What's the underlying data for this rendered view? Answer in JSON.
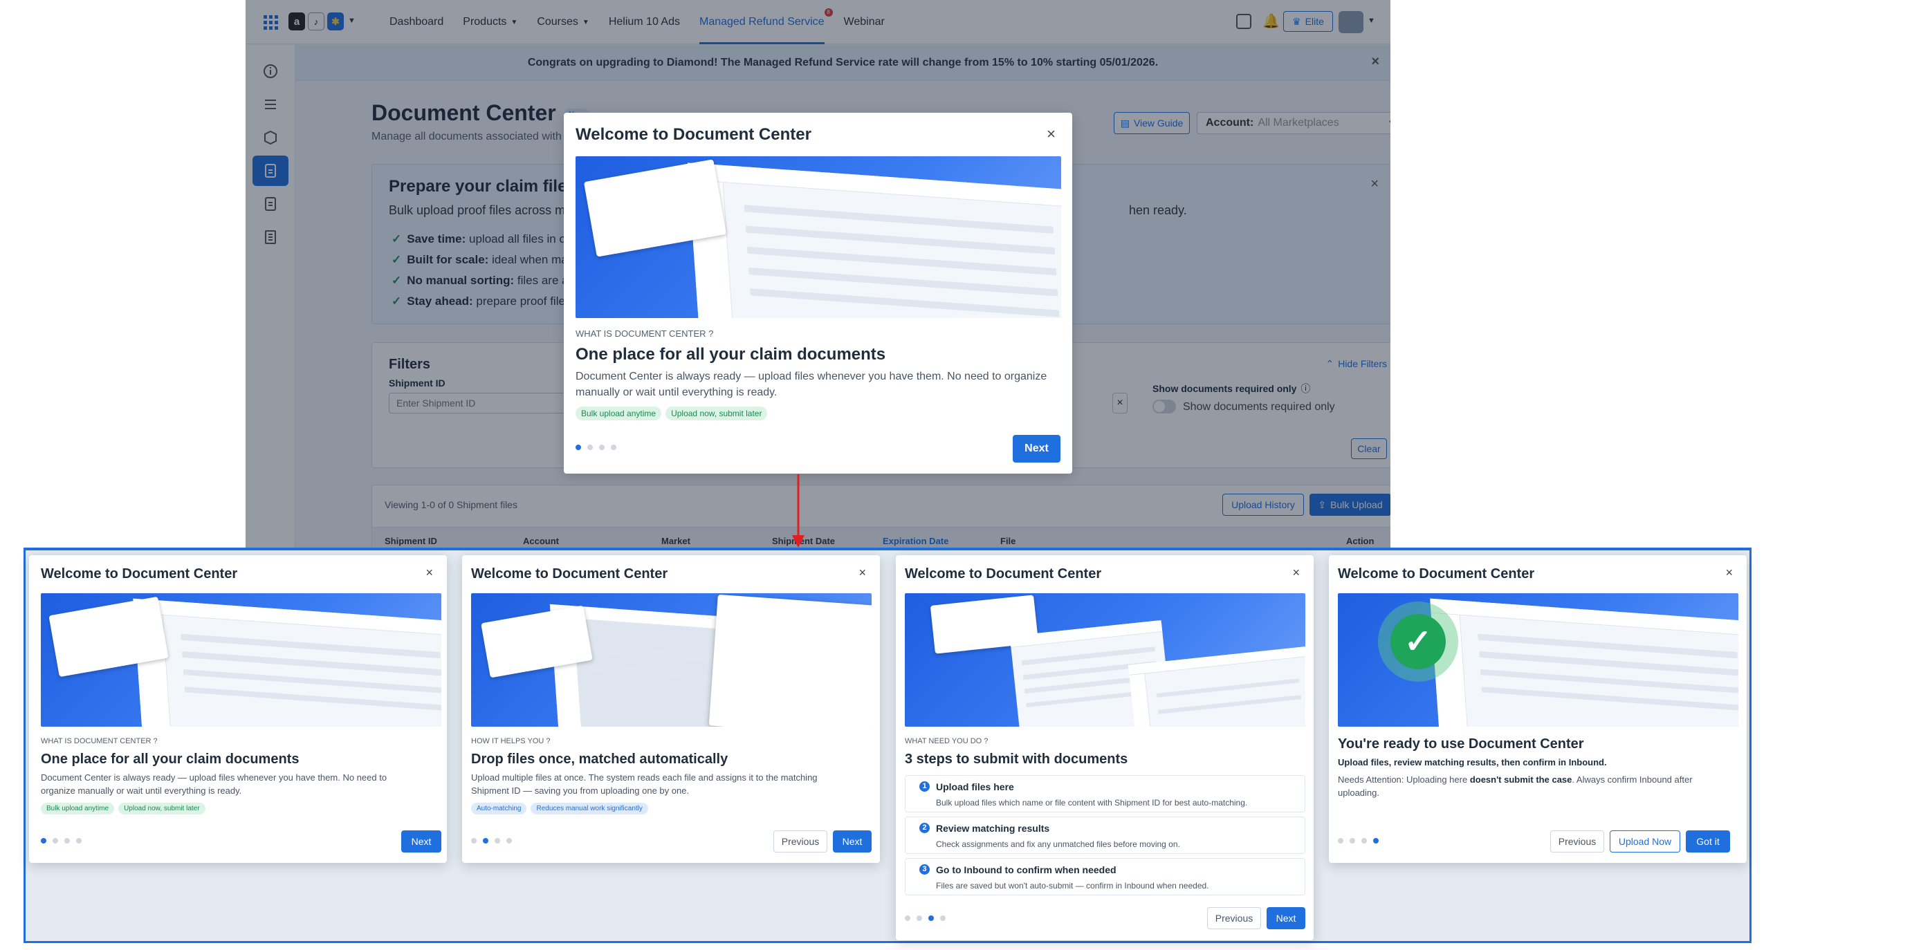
{
  "nav": {
    "items": [
      {
        "label": "Dashboard"
      },
      {
        "label": "Products"
      },
      {
        "label": "Courses"
      },
      {
        "label": "Helium 10 Ads"
      },
      {
        "label": "Managed Refund Service"
      },
      {
        "label": "Webinar"
      }
    ],
    "mrs_badge": "8",
    "plan_label": "Elite"
  },
  "banner": {
    "text": "Congrats on upgrading to Diamond! The Managed Refund Service rate will change from 15% to 10% starting 05/01/2026."
  },
  "page": {
    "title": "Document Center",
    "new_badge": "New",
    "subtitle": "Manage all documents associated with your Shipments",
    "view_guide": "View Guide",
    "account_label": "Account:",
    "account_value": "All Marketplaces"
  },
  "prepare": {
    "title": "Prepare your claim files ahead",
    "intro": "Bulk upload proof files across multiple Shipments",
    "intro_tail": "hen ready.",
    "bullets": [
      {
        "bold": "Save time:",
        "text": " upload all files in one go, n"
      },
      {
        "bold": "Built for scale:",
        "text": " ideal when managing"
      },
      {
        "bold": "No manual sorting:",
        "text": " files are auto-ma"
      },
      {
        "bold": "Stay ahead:",
        "text": " prepare proof files before"
      }
    ]
  },
  "filters": {
    "title": "Filters",
    "hide_label": "Hide Filters",
    "shipment_label": "Shipment ID",
    "shipment_placeholder": "Enter Shipment ID",
    "required_label": "Show documents required only",
    "required_toggle_label": "Show documents required only",
    "clear": "Clear"
  },
  "table": {
    "viewing": "Viewing 1-0 of 0 Shipment files",
    "upload_history": "Upload History",
    "bulk_upload": "Bulk Upload",
    "columns": [
      "Shipment ID",
      "Account",
      "Market",
      "Shipment Date",
      "Expiration Date",
      "File",
      "Action"
    ]
  },
  "modal_main": {
    "title": "Welcome to Document Center",
    "eyebrow": "WHAT IS DOCUMENT CENTER ?",
    "heading": "One place for all your claim documents",
    "body": "Document Center is always ready — upload files whenever you have them. No need to organize manually or wait until everything is ready.",
    "chips": [
      "Bulk upload anytime",
      "Upload now, submit later"
    ],
    "next": "Next"
  },
  "steps": [
    {
      "title": "Welcome to Document Center",
      "eyebrow": "WHAT IS DOCUMENT CENTER ?",
      "heading": "One place for all your claim documents",
      "body": "Document Center is always ready — upload files whenever you have them. No need to organize manually or wait until everything is ready.",
      "chips": [
        "Bulk upload anytime",
        "Upload now, submit later"
      ],
      "next": "Next"
    },
    {
      "title": "Welcome to Document Center",
      "eyebrow": "HOW IT HELPS YOU ?",
      "heading": "Drop files once, matched automatically",
      "body": "Upload multiple files at once. The system reads each file and assigns it to the matching Shipment ID — saving you from uploading one by one.",
      "chips": [
        "Auto-matching",
        "Reduces manual work significantly"
      ],
      "previous": "Previous",
      "next": "Next"
    },
    {
      "title": "Welcome to Document Center",
      "eyebrow": "WHAT NEED YOU DO ?",
      "heading": "3 steps to submit with documents",
      "items": [
        {
          "num": "1",
          "title": "Upload files here",
          "desc": "Bulk upload files which name or file content with Shipment ID for best auto-matching."
        },
        {
          "num": "2",
          "title": "Review matching results",
          "desc": "Check assignments and fix any unmatched files before moving on."
        },
        {
          "num": "3",
          "title": "Go to Inbound to confirm when needed",
          "desc": "Files are saved but won't auto-submit — confirm in Inbound when needed."
        }
      ],
      "previous": "Previous",
      "next": "Next"
    },
    {
      "title": "Welcome to Document Center",
      "heading": "You're ready to use Document Center",
      "bold_line": "Upload files, review matching results, then confirm in Inbound.",
      "body_pre": "Needs Attention: Uploading here ",
      "body_bold": "doesn't submit the case",
      "body_post": ". Always confirm Inbound after uploading.",
      "previous": "Previous",
      "upload_now": "Upload Now",
      "got_it": "Got it"
    }
  ],
  "colors": {
    "accent": "#1f6fde",
    "arrow": "#e02020",
    "chip_green": "#1a8a50",
    "highlight_border": "#1f6fde"
  }
}
